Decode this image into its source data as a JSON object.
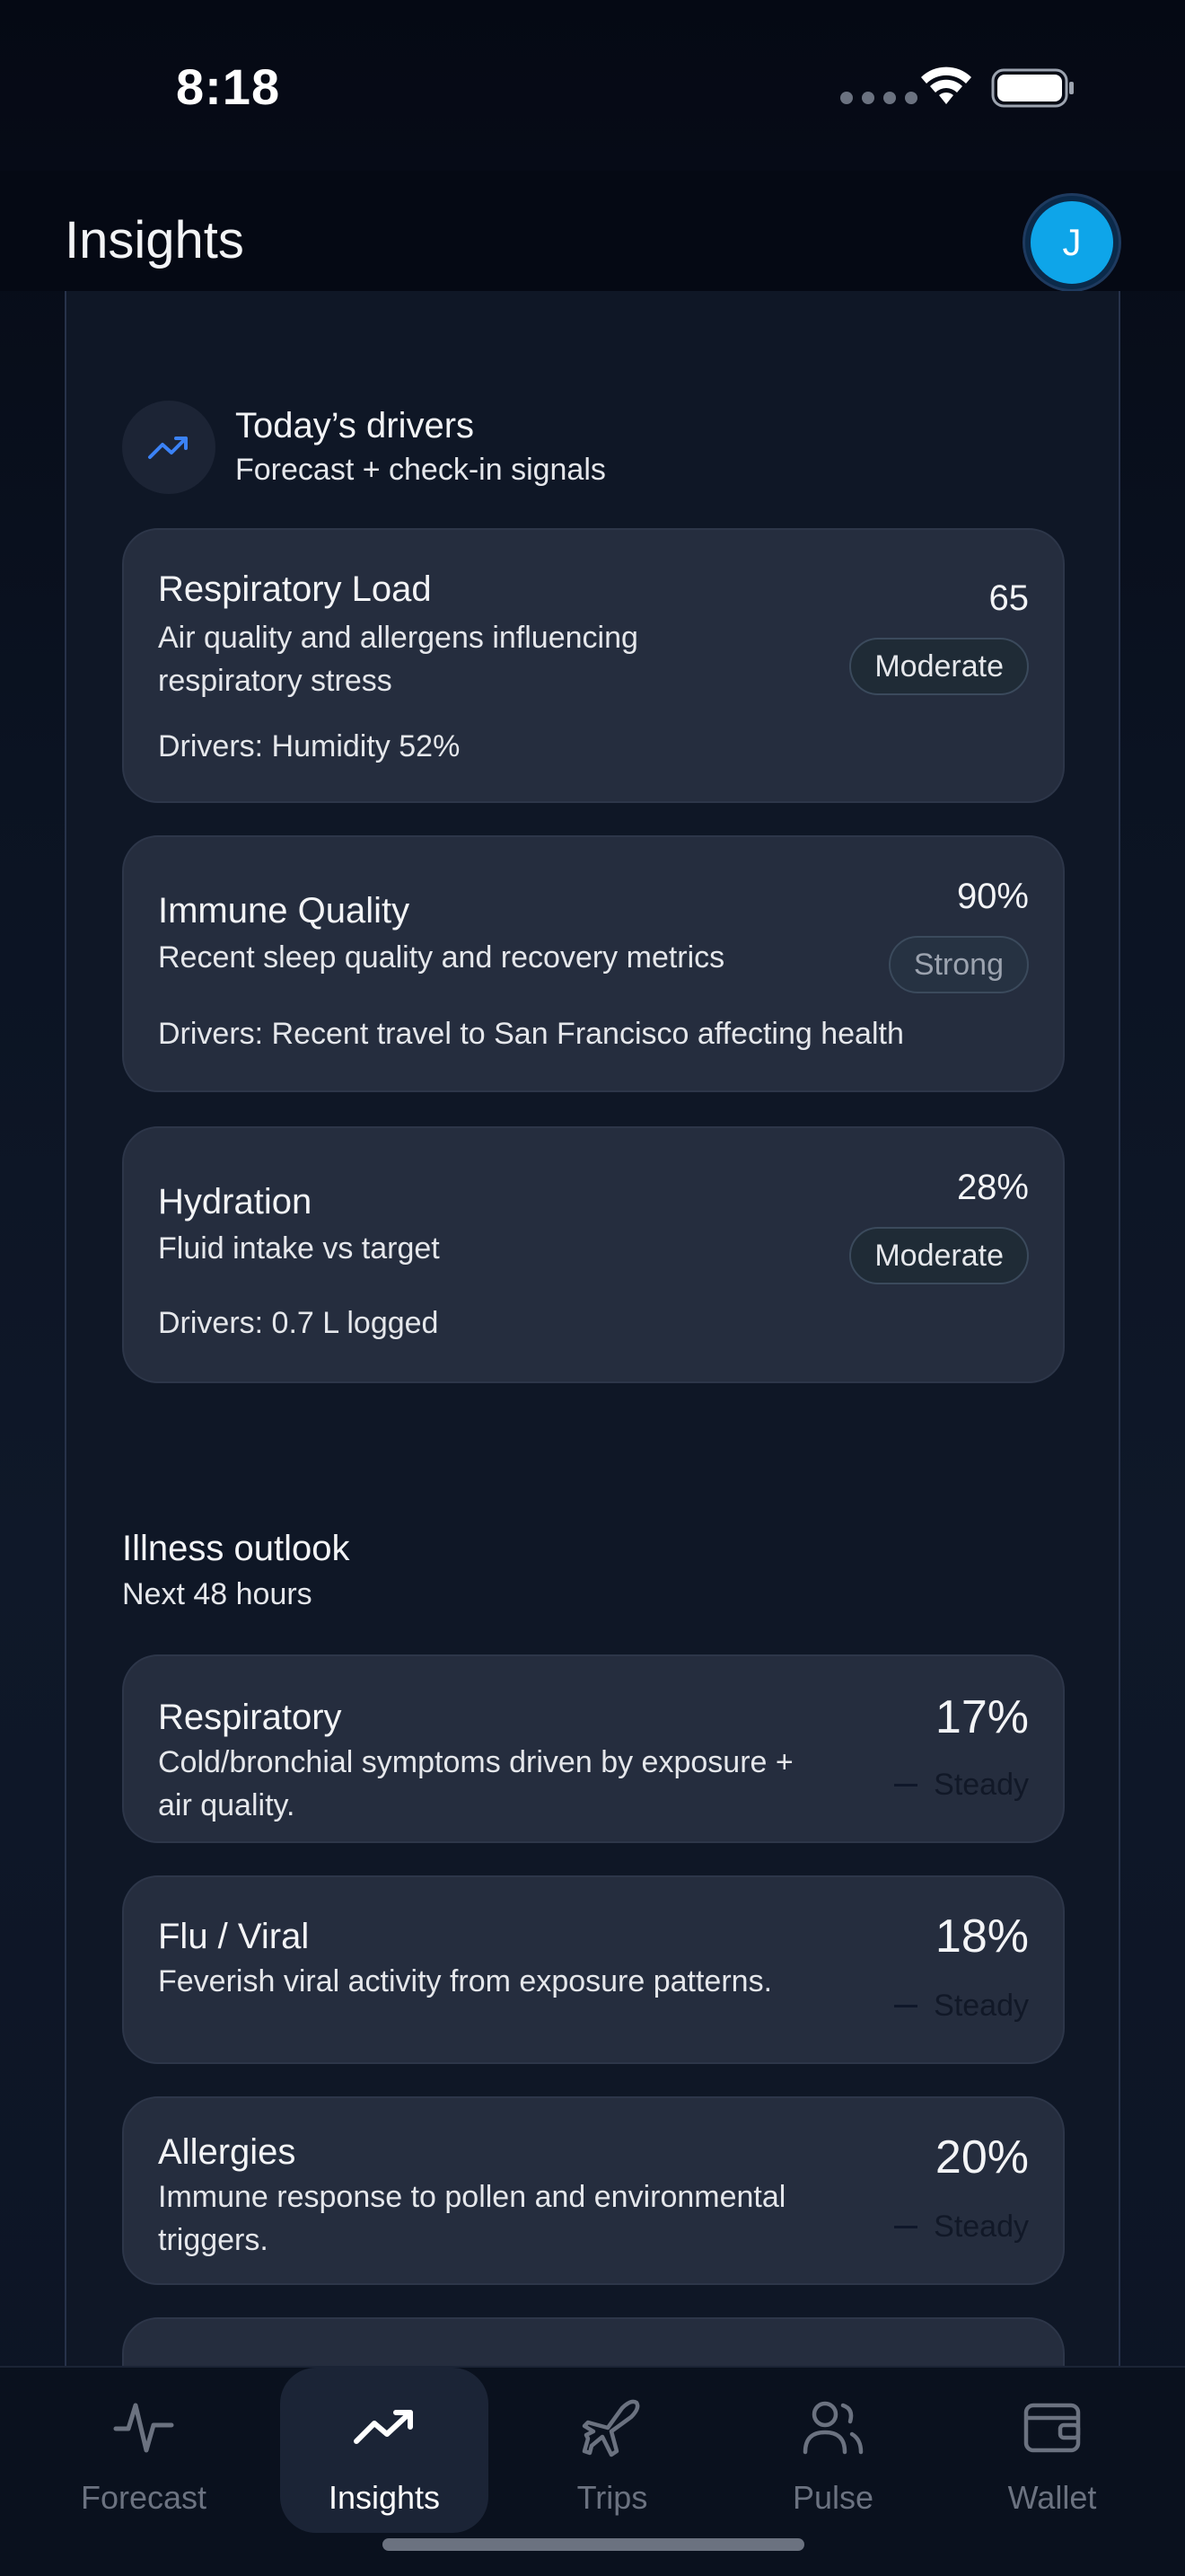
{
  "status_bar": {
    "time": "8:18"
  },
  "header": {
    "title": "Insights",
    "avatar_initial": "J"
  },
  "drivers": {
    "title": "Today’s drivers",
    "subtitle": "Forecast + check-in signals",
    "cards": [
      {
        "title": "Respiratory Load",
        "desc_line1": "Air quality and allergens influencing",
        "desc_line2": "respiratory stress",
        "drivers": "Drivers: Humidity 52%",
        "value": "65",
        "badge": "Moderate"
      },
      {
        "title": "Immune Quality",
        "desc_line1": "Recent sleep quality and recovery metrics",
        "drivers": "Drivers: Recent travel to San Francisco affecting health",
        "value": "90%",
        "badge": "Strong"
      },
      {
        "title": "Hydration",
        "desc_line1": "Fluid intake vs target",
        "drivers": "Drivers: 0.7 L logged",
        "value": "28%",
        "badge": "Moderate"
      }
    ]
  },
  "outlook": {
    "title": "Illness outlook",
    "subtitle": "Next 48 hours",
    "cards": [
      {
        "title": "Respiratory",
        "desc_line1": "Cold/bronchial symptoms driven by exposure +",
        "desc_line2": "air quality.",
        "value": "17%",
        "trend": "Steady"
      },
      {
        "title": "Flu / Viral",
        "desc_line1": "Feverish viral activity from exposure patterns.",
        "value": "18%",
        "trend": "Steady"
      },
      {
        "title": "Allergies",
        "desc_line1": "Immune response to pollen and environmental",
        "desc_line2": "triggers.",
        "value": "20%",
        "trend": "Steady"
      }
    ]
  },
  "tabbar": {
    "tabs": [
      {
        "label": "Forecast",
        "icon": "pulse-icon"
      },
      {
        "label": "Insights",
        "icon": "trending-up-icon"
      },
      {
        "label": "Trips",
        "icon": "plane-icon"
      },
      {
        "label": "Pulse",
        "icon": "users-icon"
      },
      {
        "label": "Wallet",
        "icon": "wallet-icon"
      }
    ],
    "active": "Insights"
  },
  "colors": {
    "accent": "#0ea5e9",
    "background": "#0b1120",
    "card": "#252d3e"
  }
}
